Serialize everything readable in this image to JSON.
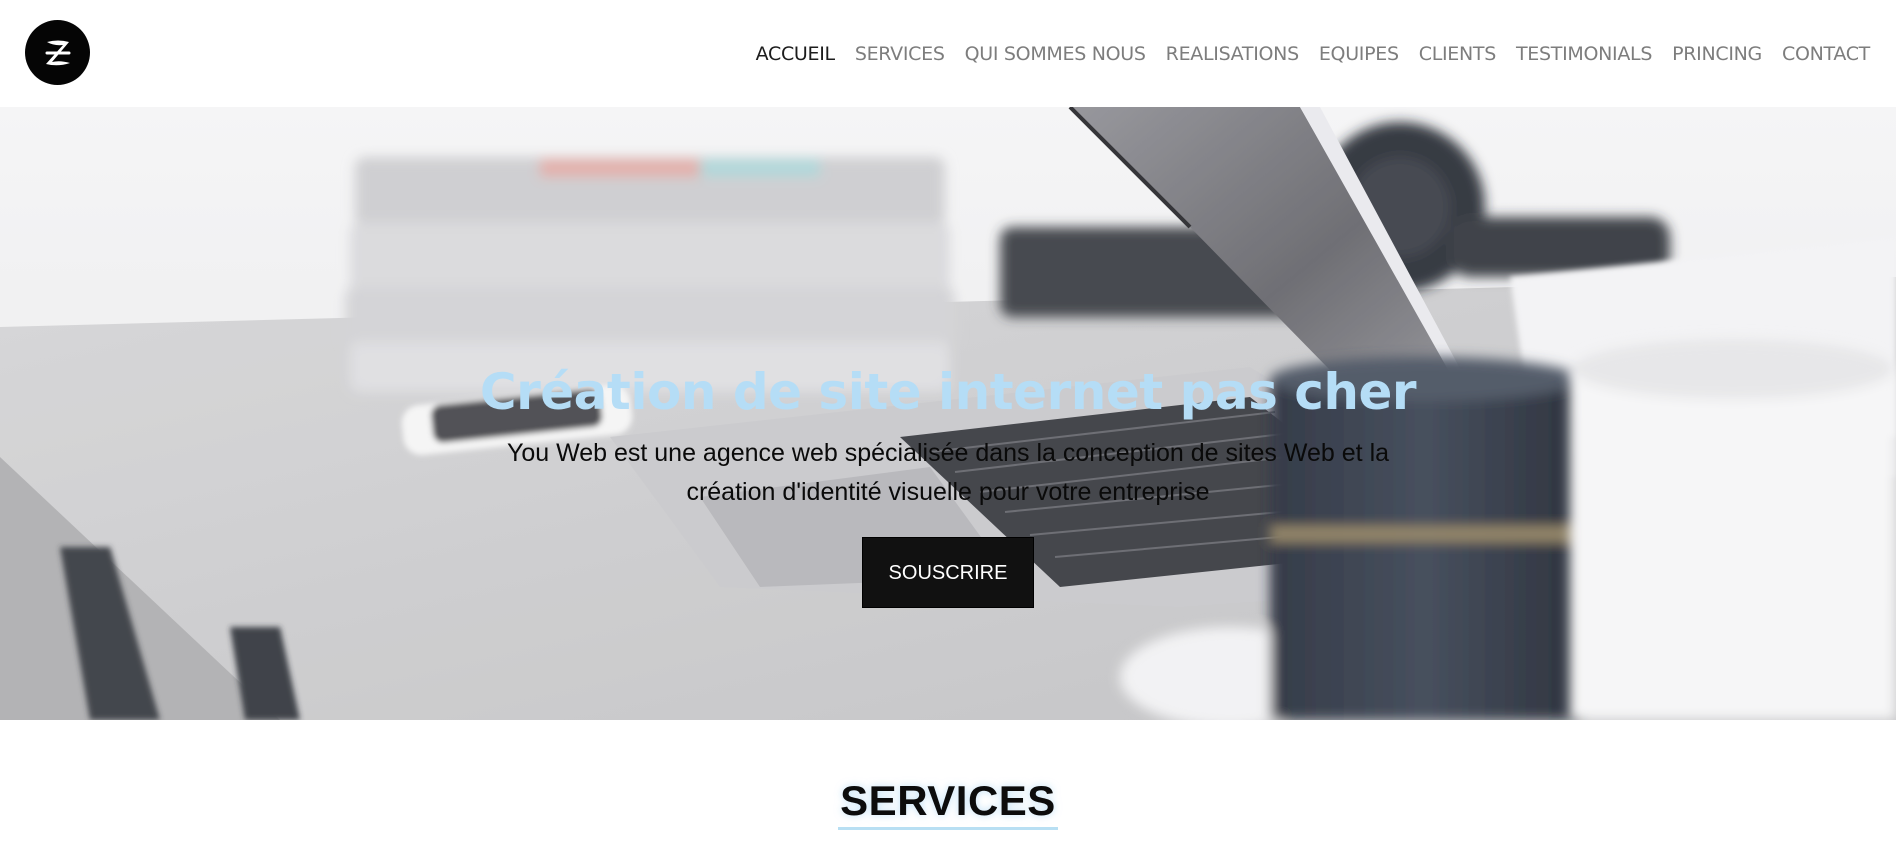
{
  "header": {
    "logo_icon": "z-logo-icon",
    "nav": [
      {
        "label": "ACCUEIL",
        "active": true
      },
      {
        "label": "SERVICES"
      },
      {
        "label": "QUI SOMMES NOUS"
      },
      {
        "label": "REALISATIONS"
      },
      {
        "label": "EQUIPES"
      },
      {
        "label": "CLIENTS"
      },
      {
        "label": "TESTIMONIALS"
      },
      {
        "label": "PRINCING"
      },
      {
        "label": "CONTACT"
      }
    ]
  },
  "hero": {
    "title": "Création de site internet pas cher",
    "subtitle_line1": "You Web est une agence web spécialisée dans la conception de sites Web et la",
    "subtitle_line2": "création d'identité visuelle pour votre entreprise",
    "cta_label": "SOUSCRIRE",
    "background_image": "laptop-desk-photo"
  },
  "services": {
    "title": "SERVICES"
  },
  "colors": {
    "hero_title": "#b5ddf6",
    "cta_bg": "#111111",
    "nav_active": "#1c1c1c",
    "nav_inactive": "#7d7d7d",
    "services_underline": "#b8dff3"
  }
}
